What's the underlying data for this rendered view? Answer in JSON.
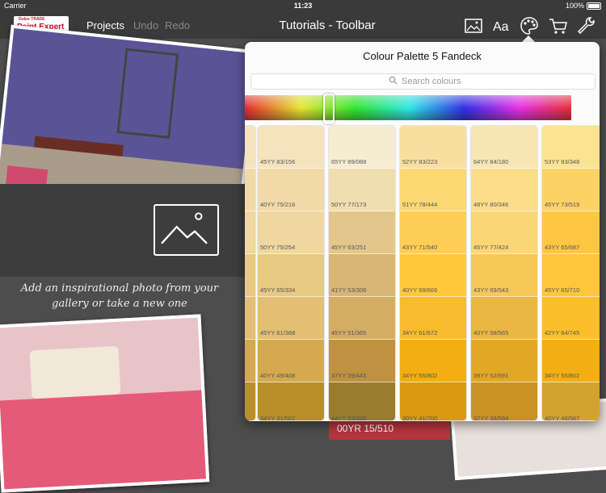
{
  "statusbar": {
    "carrier": "Carrier",
    "time": "11:23",
    "battery": "100%"
  },
  "toolbar": {
    "logo_small": "Dulux TRADE",
    "logo_big": "Paint Expert",
    "projects": "Projects",
    "undo": "Undo",
    "redo": "Redo",
    "title": "Tutorials - Toolbar",
    "icons": [
      "image-icon",
      "text-icon",
      "palette-icon",
      "cart-icon",
      "wrench-icon"
    ]
  },
  "background": {
    "inspire_text": "Add an inspirational photo from your gallery or take a new one",
    "red_bar_label": "00YR 15/510"
  },
  "popover": {
    "title": "Colour Palette 5 Fandeck",
    "search_placeholder": "Search colours"
  },
  "palette": {
    "columns": [
      {
        "cells": [
          {
            "code": "45YY 83/156",
            "color": "#f5e3bd"
          },
          {
            "code": "40YY 75/216",
            "color": "#f1d9a8"
          },
          {
            "code": "50YY 75/254",
            "color": "#efd79f"
          },
          {
            "code": "45YY 65/334",
            "color": "#e8c982"
          },
          {
            "code": "45YY 61/368",
            "color": "#e2bf72"
          },
          {
            "code": "40YY 49/408",
            "color": "#d4a950"
          },
          {
            "code": "34YY 31/502",
            "color": "#b88f2b"
          }
        ]
      },
      {
        "cells": [
          {
            "code": "65YY 89/088",
            "color": "#f6ecd1"
          },
          {
            "code": "50YY 77/173",
            "color": "#f0ddb0"
          },
          {
            "code": "45YY 63/251",
            "color": "#e4c68c"
          },
          {
            "code": "41YY 53/306",
            "color": "#d9b576"
          },
          {
            "code": "45YY 51/365",
            "color": "#d3ad63"
          },
          {
            "code": "37YY 39/443",
            "color": "#be9240"
          },
          {
            "code": "44YY 23/330",
            "color": "#9a7c2e"
          }
        ]
      },
      {
        "cells": [
          {
            "code": "52YY 83/223",
            "color": "#f8df9f"
          },
          {
            "code": "51YY 78/444",
            "color": "#fcd873"
          },
          {
            "code": "43YY 71/540",
            "color": "#fdcd55"
          },
          {
            "code": "40YY 69/666",
            "color": "#fec83a"
          },
          {
            "code": "34YY 61/672",
            "color": "#f9bb2e"
          },
          {
            "code": "34YY 55/802",
            "color": "#f2ae12"
          },
          {
            "code": "30YY 41/700",
            "color": "#d99910"
          }
        ]
      },
      {
        "cells": [
          {
            "code": "64YY 84/180",
            "color": "#f7e6b3"
          },
          {
            "code": "48YY 80/346",
            "color": "#fbdd8a"
          },
          {
            "code": "45YY 77/424",
            "color": "#fbd677"
          },
          {
            "code": "43YY 69/543",
            "color": "#f5c858"
          },
          {
            "code": "40YY 58/565",
            "color": "#ebb743"
          },
          {
            "code": "39YY 52/691",
            "color": "#e2a725"
          },
          {
            "code": "37YY 38/594",
            "color": "#c99224"
          }
        ]
      },
      {
        "cells": [
          {
            "code": "53YY 83/348",
            "color": "#fbe391"
          },
          {
            "code": "45YY 73/519",
            "color": "#fdd265"
          },
          {
            "code": "43YY 65/687",
            "color": "#fec743"
          },
          {
            "code": "45YY 65/710",
            "color": "#fec53d"
          },
          {
            "code": "42YY 64/745",
            "color": "#fcbf2c"
          },
          {
            "code": "34YY 55/802",
            "color": "#f2ae12"
          },
          {
            "code": "40YY 46/587",
            "color": "#d4a22e"
          }
        ]
      }
    ]
  }
}
